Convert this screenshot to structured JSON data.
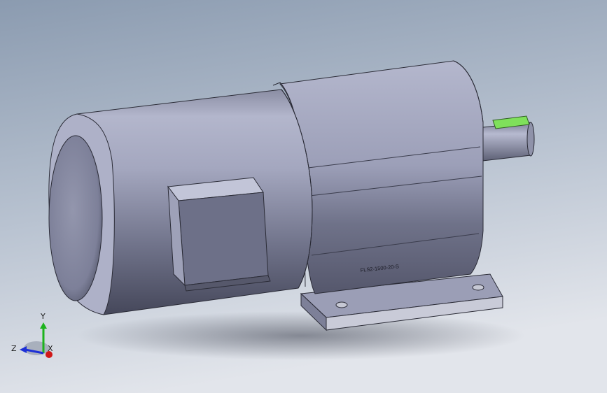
{
  "model": {
    "nameplate_text": "FLS2-1500-20-S",
    "body_color": "#9a9db6",
    "key_color": "#7ee05a",
    "background_top": "#8d9db1",
    "background_bottom": "#dfe3ea"
  },
  "triad": {
    "x_label": "X",
    "y_label": "Y",
    "z_label": "Z",
    "x_color": "#d01818",
    "y_color": "#1db31d",
    "z_color": "#1c2fd6"
  }
}
